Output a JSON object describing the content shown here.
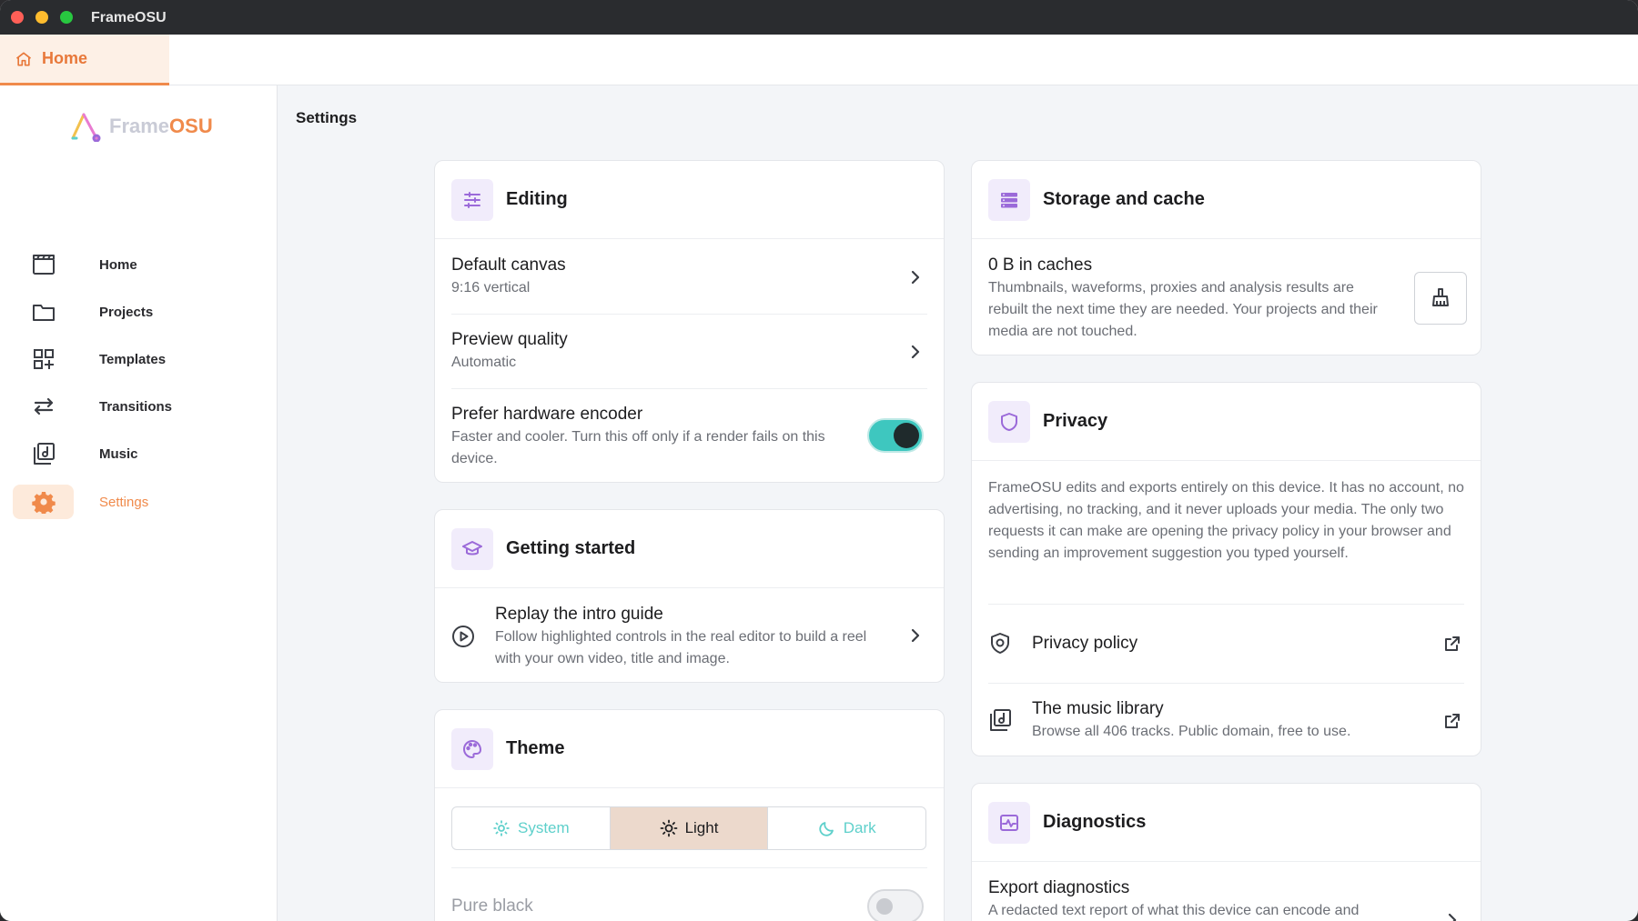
{
  "window": {
    "title": "FrameOSU"
  },
  "tab": {
    "label": "Home"
  },
  "logo": {
    "frame": "Frame",
    "osu": "OSU"
  },
  "nav": [
    {
      "label": "Home",
      "icon": "clapperboard-icon"
    },
    {
      "label": "Projects",
      "icon": "folder-icon"
    },
    {
      "label": "Templates",
      "icon": "grid-plus-icon"
    },
    {
      "label": "Transitions",
      "icon": "arrows-icon"
    },
    {
      "label": "Music",
      "icon": "music-library-icon"
    },
    {
      "label": "Settings",
      "icon": "gear-icon",
      "active": true
    }
  ],
  "page": {
    "title": "Settings"
  },
  "editing": {
    "title": "Editing",
    "default_canvas": {
      "title": "Default canvas",
      "value": "9:16 vertical"
    },
    "preview_quality": {
      "title": "Preview quality",
      "value": "Automatic"
    },
    "hardware_encoder": {
      "title": "Prefer hardware encoder",
      "description": "Faster and cooler. Turn this off only if a render fails on this device.",
      "enabled": true
    }
  },
  "getting_started": {
    "title": "Getting started",
    "replay": {
      "title": "Replay the intro guide",
      "description": "Follow highlighted controls in the real editor to build a reel with your own video, title and image."
    }
  },
  "theme": {
    "title": "Theme",
    "options": [
      "System",
      "Light",
      "Dark"
    ],
    "selected": "Light",
    "pure_black": {
      "title": "Pure black",
      "enabled": false
    }
  },
  "storage": {
    "title": "Storage and cache",
    "caches": "0 B in caches",
    "description": "Thumbnails, waveforms, proxies and analysis results are rebuilt the next time they are needed. Your projects and their media are not touched."
  },
  "privacy": {
    "title": "Privacy",
    "description": "FrameOSU edits and exports entirely on this device. It has no account, no advertising, no tracking, and it never uploads your media. The only two requests it can make are opening the privacy policy in your browser and sending an improvement suggestion you typed yourself.",
    "policy": {
      "title": "Privacy policy"
    },
    "music": {
      "title": "The music library",
      "description": "Browse all 406 tracks. Public domain, free to use."
    }
  },
  "diagnostics": {
    "title": "Diagnostics",
    "export": {
      "title": "Export diagnostics",
      "description": "A redacted text report of what this device can encode and"
    }
  },
  "colors": {
    "accent": "#f08a4b",
    "teal": "#3ec7bf",
    "purple": "#9b6ad9"
  }
}
